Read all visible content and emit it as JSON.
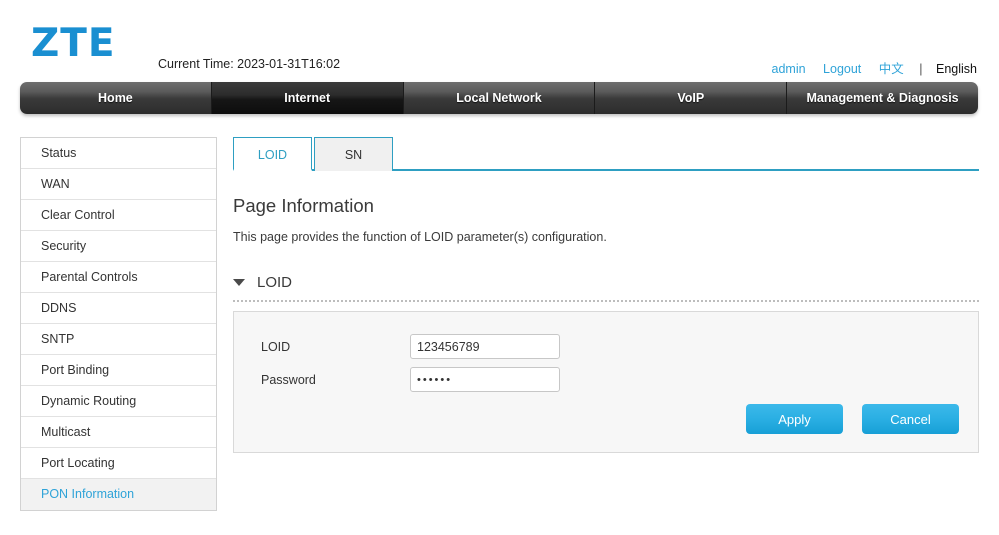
{
  "header": {
    "logo_text": "ZTE",
    "current_time_label": "Current Time: 2023-01-31T16:02",
    "account": {
      "user": "admin",
      "logout": "Logout",
      "lang_chinese": "中文",
      "lang_separator": "|",
      "lang_english": "English"
    },
    "logo_color": "#1a8fd1",
    "link_color": "#2fa3d8"
  },
  "nav": {
    "items": [
      {
        "label": "Home",
        "active": false
      },
      {
        "label": "Internet",
        "active": true
      },
      {
        "label": "Local Network",
        "active": false
      },
      {
        "label": "VoIP",
        "active": false
      },
      {
        "label": "Management & Diagnosis",
        "active": false
      }
    ]
  },
  "sidebar": {
    "items": [
      {
        "label": "Status",
        "active": false
      },
      {
        "label": "WAN",
        "active": false
      },
      {
        "label": "Clear Control",
        "active": false
      },
      {
        "label": "Security",
        "active": false
      },
      {
        "label": "Parental Controls",
        "active": false
      },
      {
        "label": "DDNS",
        "active": false
      },
      {
        "label": "SNTP",
        "active": false
      },
      {
        "label": "Port Binding",
        "active": false
      },
      {
        "label": "Dynamic Routing",
        "active": false
      },
      {
        "label": "Multicast",
        "active": false
      },
      {
        "label": "Port Locating",
        "active": false
      },
      {
        "label": "PON Information",
        "active": true
      }
    ]
  },
  "content": {
    "tabs": [
      {
        "label": "LOID",
        "active": true
      },
      {
        "label": "SN",
        "active": false
      }
    ],
    "page_title": "Page Information",
    "page_description": "This page provides the function of LOID parameter(s) configuration.",
    "section": {
      "title": "LOID",
      "caret": "caret-down-icon",
      "fields": [
        {
          "label": "LOID",
          "value": "123456789",
          "placeholder": "",
          "type": "text"
        },
        {
          "label": "Password",
          "value": "••••••",
          "placeholder": "",
          "type": "password"
        }
      ],
      "buttons": [
        {
          "label": "Apply",
          "name": "apply-button"
        },
        {
          "label": "Cancel",
          "name": "cancel-button"
        }
      ]
    },
    "accent_color": "#2e9fc2",
    "button_color": "#2aafe3"
  }
}
